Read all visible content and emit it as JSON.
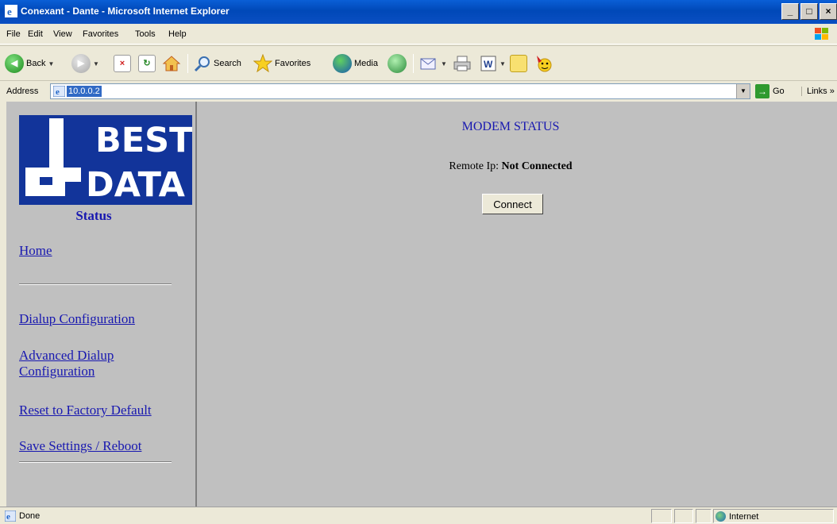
{
  "window": {
    "title": "Conexant - Dante - Microsoft Internet Explorer",
    "controls": [
      "_",
      "□",
      "×"
    ]
  },
  "menu": [
    "File",
    "Edit",
    "View",
    "Favorites",
    "Tools",
    "Help"
  ],
  "toolbar": {
    "back_label": "Back",
    "search_label": "Search",
    "favorites_label": "Favorites",
    "media_label": "Media"
  },
  "address": {
    "label": "Address",
    "value": "10.0.0.2",
    "go_label": "Go",
    "links_label": "Links",
    "links_chevron": "»"
  },
  "sidebar": {
    "logo_text_top": "BEST",
    "logo_text_bottom": "DATA",
    "section_title": "Status",
    "items": [
      {
        "label": "Home"
      },
      {
        "label": "Dialup Configuration"
      },
      {
        "label": "Advanced Dialup Configuration",
        "line1": "Advanced Dialup",
        "line2": "Configuration"
      },
      {
        "label": "Reset to Factory Default"
      },
      {
        "label": "Save Settings / Reboot"
      }
    ]
  },
  "main": {
    "title": "MODEM STATUS",
    "remote_label": "Remote Ip:",
    "remote_value": "Not Connected",
    "connect_label": "Connect"
  },
  "status": {
    "text": "Done",
    "zone": "Internet"
  },
  "colors": {
    "link": "#1818b0",
    "logo_blue": "#12349a",
    "content_bg": "#c0c0c0"
  }
}
